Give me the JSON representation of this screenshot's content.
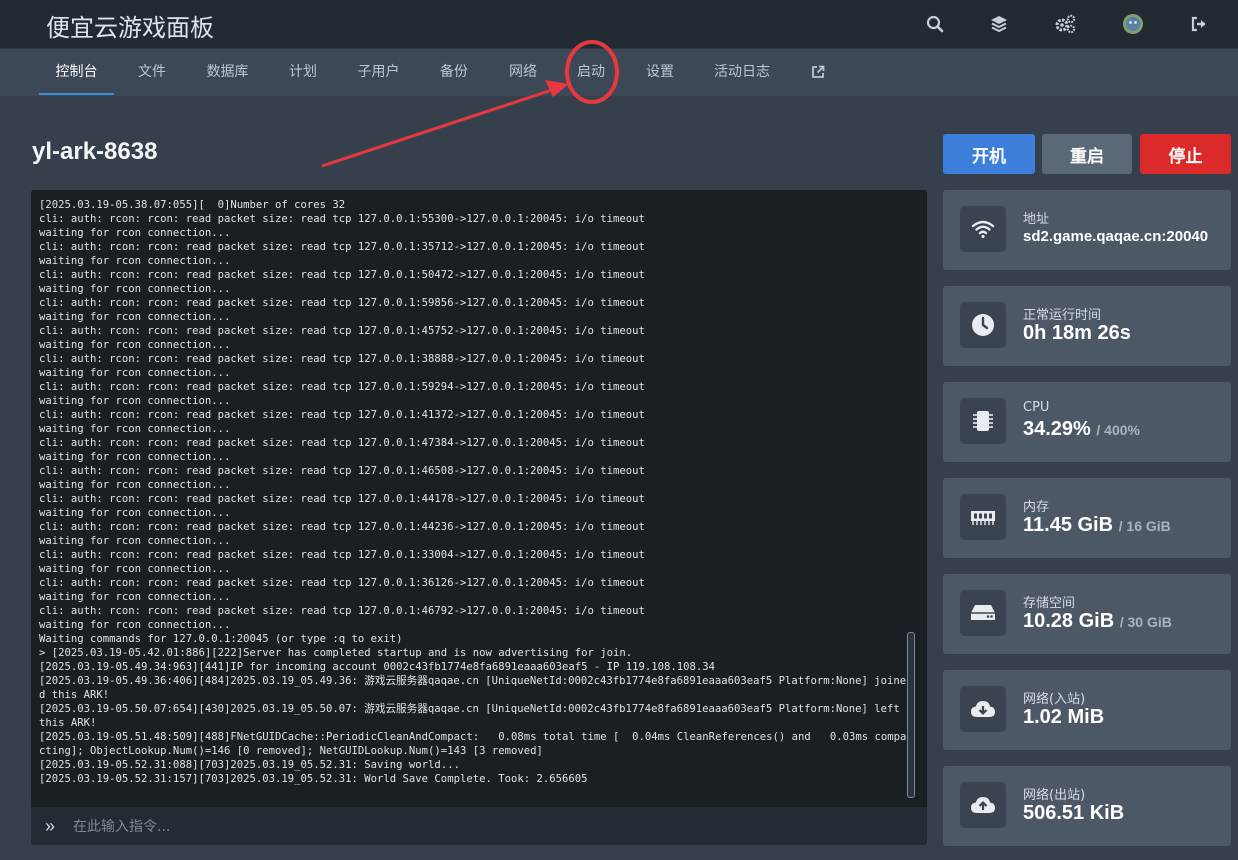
{
  "header": {
    "brand": "便宜云游戏面板",
    "icons": [
      "search-icon",
      "layers-icon",
      "gears-icon",
      "avatar",
      "sign-out-icon"
    ]
  },
  "nav": {
    "items": [
      {
        "label": "控制台",
        "active": true
      },
      {
        "label": "文件"
      },
      {
        "label": "数据库"
      },
      {
        "label": "计划"
      },
      {
        "label": "子用户"
      },
      {
        "label": "备份"
      },
      {
        "label": "网络"
      },
      {
        "label": "启动"
      },
      {
        "label": "设置"
      },
      {
        "label": "活动日志"
      }
    ],
    "external_icon": "external-link-icon"
  },
  "server": {
    "name": "yl-ark-8638"
  },
  "power": {
    "start": "开机",
    "restart": "重启",
    "stop": "停止"
  },
  "console": {
    "lines": [
      "[2025.03.19-05.38.07:055][  0]Number of cores 32",
      "cli: auth: rcon: rcon: read packet size: read tcp 127.0.0.1:55300->127.0.0.1:20045: i/o timeout",
      "waiting for rcon connection...",
      "cli: auth: rcon: rcon: read packet size: read tcp 127.0.0.1:35712->127.0.0.1:20045: i/o timeout",
      "waiting for rcon connection...",
      "cli: auth: rcon: rcon: read packet size: read tcp 127.0.0.1:50472->127.0.0.1:20045: i/o timeout",
      "waiting for rcon connection...",
      "cli: auth: rcon: rcon: read packet size: read tcp 127.0.0.1:59856->127.0.0.1:20045: i/o timeout",
      "waiting for rcon connection...",
      "cli: auth: rcon: rcon: read packet size: read tcp 127.0.0.1:45752->127.0.0.1:20045: i/o timeout",
      "waiting for rcon connection...",
      "cli: auth: rcon: rcon: read packet size: read tcp 127.0.0.1:38888->127.0.0.1:20045: i/o timeout",
      "waiting for rcon connection...",
      "cli: auth: rcon: rcon: read packet size: read tcp 127.0.0.1:59294->127.0.0.1:20045: i/o timeout",
      "waiting for rcon connection...",
      "cli: auth: rcon: rcon: read packet size: read tcp 127.0.0.1:41372->127.0.0.1:20045: i/o timeout",
      "waiting for rcon connection...",
      "cli: auth: rcon: rcon: read packet size: read tcp 127.0.0.1:47384->127.0.0.1:20045: i/o timeout",
      "waiting for rcon connection...",
      "cli: auth: rcon: rcon: read packet size: read tcp 127.0.0.1:46508->127.0.0.1:20045: i/o timeout",
      "waiting for rcon connection...",
      "cli: auth: rcon: rcon: read packet size: read tcp 127.0.0.1:44178->127.0.0.1:20045: i/o timeout",
      "waiting for rcon connection...",
      "cli: auth: rcon: rcon: read packet size: read tcp 127.0.0.1:44236->127.0.0.1:20045: i/o timeout",
      "waiting for rcon connection...",
      "cli: auth: rcon: rcon: read packet size: read tcp 127.0.0.1:33004->127.0.0.1:20045: i/o timeout",
      "waiting for rcon connection...",
      "cli: auth: rcon: rcon: read packet size: read tcp 127.0.0.1:36126->127.0.0.1:20045: i/o timeout",
      "waiting for rcon connection...",
      "cli: auth: rcon: rcon: read packet size: read tcp 127.0.0.1:46792->127.0.0.1:20045: i/o timeout",
      "waiting for rcon connection...",
      "Waiting commands for 127.0.0.1:20045 (or type :q to exit)",
      "> [2025.03.19-05.42.01:886][222]Server has completed startup and is now advertising for join.",
      "[2025.03.19-05.49.34:963][441]IP for incoming account 0002c43fb1774e8fa6891eaaa603eaf5 - IP 119.108.108.34",
      "[2025.03.19-05.49.36:406][484]2025.03.19_05.49.36: 游戏云服务器qaqae.cn [UniqueNetId:0002c43fb1774e8fa6891eaaa603eaf5 Platform:None] joined this ARK!",
      "[2025.03.19-05.50.07:654][430]2025.03.19_05.50.07: 游戏云服务器qaqae.cn [UniqueNetId:0002c43fb1774e8fa6891eaaa603eaf5 Platform:None] left this ARK!",
      "[2025.03.19-05.51.48:509][488]FNetGUIDCache::PeriodicCleanAndCompact:   0.08ms total time [  0.04ms CleanReferences() and   0.03ms compacting]; ObjectLookup.Num()=146 [0 removed]; NetGUIDLookup.Num()=143 [3 removed]",
      "[2025.03.19-05.52.31:088][703]2025.03.19_05.52.31: Saving world...",
      "[2025.03.19-05.52.31:157][703]2025.03.19_05.52.31: World Save Complete. Took: 2.656605"
    ],
    "input_placeholder": "在此输入指令..."
  },
  "stats": [
    {
      "label": "地址",
      "value": "sd2.game.qaqae.cn:20040",
      "sub": "",
      "icon": "wifi-icon"
    },
    {
      "label": "正常运行时间",
      "value": "0h 18m 26s",
      "sub": "",
      "icon": "clock-icon"
    },
    {
      "label": "CPU",
      "value": "34.29%",
      "sub": "/ 400%",
      "icon": "cpu-icon"
    },
    {
      "label": "内存",
      "value": "11.45 GiB",
      "sub": "/ 16 GiB",
      "icon": "memory-icon"
    },
    {
      "label": "存储空间",
      "value": "10.28 GiB",
      "sub": "/ 30 GiB",
      "icon": "hdd-icon"
    },
    {
      "label": "网络(入站)",
      "value": "1.02 MiB",
      "sub": "",
      "icon": "cloud-download-icon"
    },
    {
      "label": "网络(出站)",
      "value": "506.51 KiB",
      "sub": "",
      "icon": "cloud-upload-icon"
    }
  ],
  "colors": {
    "start": "#3f7fdc",
    "restart": "#5b6877",
    "stop": "#dc2a2a",
    "annotation": "#e8383d"
  }
}
